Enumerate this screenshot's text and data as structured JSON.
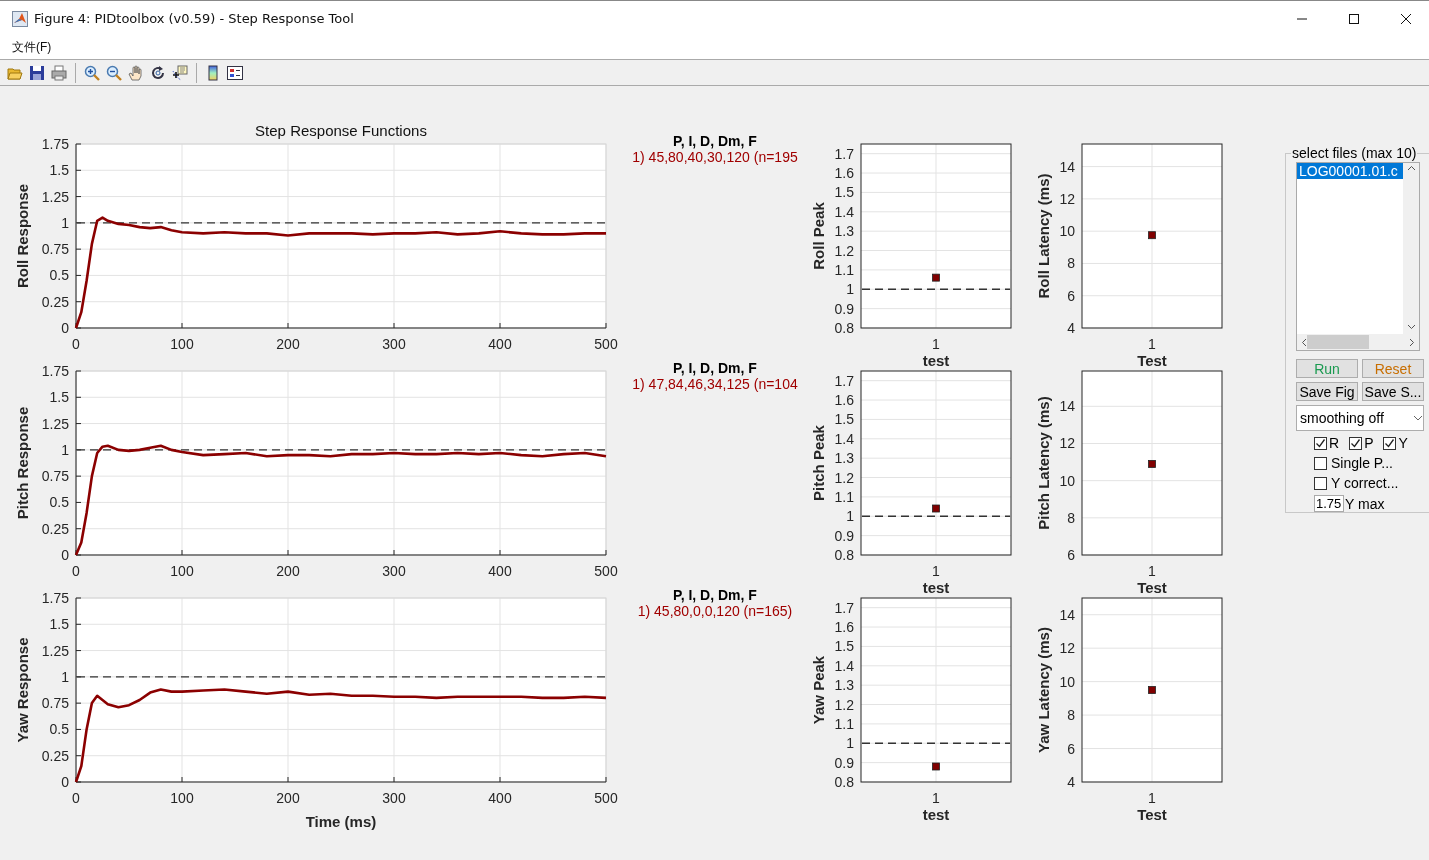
{
  "window": {
    "title": "Figure 4: PIDtoolbox (v0.59) - Step Response Tool"
  },
  "menu": [
    "文件(F)"
  ],
  "rows": [
    {
      "step": {
        "chart_data": {
          "type": "line",
          "title": "Step Response Functions",
          "ylabel": "Roll Response",
          "x": [
            0,
            5,
            10,
            15,
            20,
            25,
            30,
            40,
            50,
            60,
            70,
            80,
            90,
            100,
            120,
            140,
            160,
            180,
            200,
            220,
            240,
            260,
            280,
            300,
            320,
            340,
            360,
            380,
            400,
            420,
            440,
            460,
            480,
            500
          ],
          "series": [
            {
              "color": "#8b0000",
              "values": [
                0,
                0.15,
                0.45,
                0.8,
                1.02,
                1.05,
                1.02,
                0.99,
                0.98,
                0.96,
                0.95,
                0.96,
                0.93,
                0.91,
                0.9,
                0.91,
                0.9,
                0.9,
                0.88,
                0.9,
                0.9,
                0.9,
                0.89,
                0.9,
                0.9,
                0.91,
                0.89,
                0.9,
                0.92,
                0.9,
                0.89,
                0.89,
                0.9,
                0.9
              ]
            }
          ],
          "xlim": [
            0,
            500
          ],
          "ylim": [
            0,
            1.75
          ],
          "xticks": [
            0,
            100,
            200,
            300,
            400,
            500
          ],
          "yticks": [
            0,
            0.25,
            0.5,
            0.75,
            1,
            1.25,
            1.5,
            1.75
          ],
          "grid": true,
          "ref_lines": [
            {
              "axis": "y",
              "value": 1
            }
          ]
        }
      },
      "pid_header": "P, I, D, Dm, F",
      "pid_values": "1) 45,80,40,30,120  (n=195",
      "peak": {
        "chart_data": {
          "type": "scatter",
          "ylabel": "Roll Peak",
          "xlabel": "test",
          "categories": [
            "1"
          ],
          "series": [
            {
              "color": "#800000",
              "values": [
                1.06
              ]
            }
          ],
          "ylim": [
            0.8,
            1.75
          ],
          "yticks": [
            0.8,
            0.9,
            1,
            1.1,
            1.2,
            1.3,
            1.4,
            1.5,
            1.6,
            1.7
          ],
          "grid": true,
          "ref_lines": [
            {
              "axis": "y",
              "value": 1
            }
          ]
        }
      },
      "latency": {
        "chart_data": {
          "type": "scatter",
          "ylabel": "Roll Latency (ms)",
          "xlabel": "Test",
          "categories": [
            "1"
          ],
          "series": [
            {
              "color": "#800000",
              "values": [
                9.75
              ]
            }
          ],
          "ylim": [
            4,
            15.4
          ],
          "yticks": [
            4,
            6,
            8,
            10,
            12,
            14
          ],
          "grid": true
        }
      }
    },
    {
      "step": {
        "chart_data": {
          "type": "line",
          "ylabel": "Pitch Response",
          "x": [
            0,
            5,
            10,
            15,
            20,
            25,
            30,
            40,
            50,
            60,
            70,
            80,
            90,
            100,
            120,
            140,
            160,
            180,
            200,
            220,
            240,
            260,
            280,
            300,
            320,
            340,
            360,
            380,
            400,
            420,
            440,
            460,
            480,
            500
          ],
          "series": [
            {
              "color": "#8b0000",
              "values": [
                0,
                0.12,
                0.4,
                0.75,
                0.97,
                1.03,
                1.04,
                1.0,
                0.99,
                1.0,
                1.02,
                1.04,
                1.0,
                0.98,
                0.95,
                0.96,
                0.97,
                0.94,
                0.95,
                0.95,
                0.94,
                0.96,
                0.96,
                0.97,
                0.96,
                0.96,
                0.97,
                0.96,
                0.97,
                0.95,
                0.94,
                0.96,
                0.97,
                0.94
              ]
            }
          ],
          "xlim": [
            0,
            500
          ],
          "ylim": [
            0,
            1.75
          ],
          "xticks": [
            0,
            100,
            200,
            300,
            400,
            500
          ],
          "yticks": [
            0,
            0.25,
            0.5,
            0.75,
            1,
            1.25,
            1.5,
            1.75
          ],
          "grid": true,
          "ref_lines": [
            {
              "axis": "y",
              "value": 1
            }
          ]
        }
      },
      "pid_header": "P, I, D, Dm, F",
      "pid_values": "1) 47,84,46,34,125  (n=104",
      "peak": {
        "chart_data": {
          "type": "scatter",
          "ylabel": "Pitch Peak",
          "xlabel": "test",
          "categories": [
            "1"
          ],
          "series": [
            {
              "color": "#800000",
              "values": [
                1.04
              ]
            }
          ],
          "ylim": [
            0.8,
            1.75
          ],
          "yticks": [
            0.8,
            0.9,
            1,
            1.1,
            1.2,
            1.3,
            1.4,
            1.5,
            1.6,
            1.7
          ],
          "grid": true,
          "ref_lines": [
            {
              "axis": "y",
              "value": 1
            }
          ]
        }
      },
      "latency": {
        "chart_data": {
          "type": "scatter",
          "ylabel": "Pitch Latency (ms)",
          "xlabel": "Test",
          "categories": [
            "1"
          ],
          "series": [
            {
              "color": "#800000",
              "values": [
                10.9
              ]
            }
          ],
          "ylim": [
            6,
            15.9
          ],
          "yticks": [
            6,
            8,
            10,
            12,
            14
          ],
          "grid": true
        }
      }
    },
    {
      "step": {
        "chart_data": {
          "type": "line",
          "ylabel": "Yaw Response",
          "xlabel": "Time (ms)",
          "x": [
            0,
            5,
            10,
            15,
            20,
            25,
            30,
            40,
            50,
            60,
            70,
            80,
            90,
            100,
            120,
            140,
            160,
            180,
            200,
            220,
            240,
            260,
            280,
            300,
            320,
            340,
            360,
            380,
            400,
            420,
            440,
            460,
            480,
            500
          ],
          "series": [
            {
              "color": "#8b0000",
              "values": [
                0,
                0.15,
                0.5,
                0.75,
                0.82,
                0.78,
                0.74,
                0.71,
                0.73,
                0.78,
                0.85,
                0.88,
                0.86,
                0.86,
                0.87,
                0.88,
                0.86,
                0.84,
                0.86,
                0.83,
                0.84,
                0.82,
                0.82,
                0.81,
                0.81,
                0.8,
                0.81,
                0.81,
                0.81,
                0.81,
                0.8,
                0.8,
                0.81,
                0.8
              ]
            }
          ],
          "xlim": [
            0,
            500
          ],
          "ylim": [
            0,
            1.75
          ],
          "xticks": [
            0,
            100,
            200,
            300,
            400,
            500
          ],
          "yticks": [
            0,
            0.25,
            0.5,
            0.75,
            1,
            1.25,
            1.5,
            1.75
          ],
          "grid": true,
          "ref_lines": [
            {
              "axis": "y",
              "value": 1
            }
          ]
        }
      },
      "pid_header": "P, I, D, Dm, F",
      "pid_values": "1) 45,80,0,0,120  (n=165)",
      "peak": {
        "chart_data": {
          "type": "scatter",
          "ylabel": "Yaw Peak",
          "xlabel": "test",
          "categories": [
            "1"
          ],
          "series": [
            {
              "color": "#800000",
              "values": [
                0.88
              ]
            }
          ],
          "ylim": [
            0.8,
            1.75
          ],
          "yticks": [
            0.8,
            0.9,
            1,
            1.1,
            1.2,
            1.3,
            1.4,
            1.5,
            1.6,
            1.7
          ],
          "grid": true,
          "ref_lines": [
            {
              "axis": "y",
              "value": 1
            }
          ]
        }
      },
      "latency": {
        "chart_data": {
          "type": "scatter",
          "ylabel": "Yaw Latency (ms)",
          "xlabel": "Test",
          "categories": [
            "1"
          ],
          "series": [
            {
              "color": "#800000",
              "values": [
                9.5
              ]
            }
          ],
          "ylim": [
            4,
            15
          ],
          "yticks": [
            4,
            6,
            8,
            10,
            12,
            14
          ],
          "grid": true
        }
      }
    }
  ],
  "panel": {
    "legend": "select files (max 10)",
    "files": [
      {
        "label": "LOG00001.01.c",
        "selected": true
      }
    ],
    "buttons": [
      {
        "label": "Run",
        "color": "#1a9a50"
      },
      {
        "label": "Reset",
        "color": "#c86e00"
      },
      {
        "label": "Save Fig",
        "color": "#000000"
      },
      {
        "label": "Save S...",
        "color": "#000000"
      }
    ],
    "smoothing": {
      "value": "smoothing off"
    },
    "axes": [
      {
        "label": "R",
        "checked": true
      },
      {
        "label": "P",
        "checked": true
      },
      {
        "label": "Y",
        "checked": true
      }
    ],
    "options": [
      {
        "label": "Single P...",
        "checked": false
      },
      {
        "label": "Y correct...",
        "checked": false
      }
    ],
    "ymax": {
      "value": "1.75",
      "label": "Y max"
    }
  }
}
